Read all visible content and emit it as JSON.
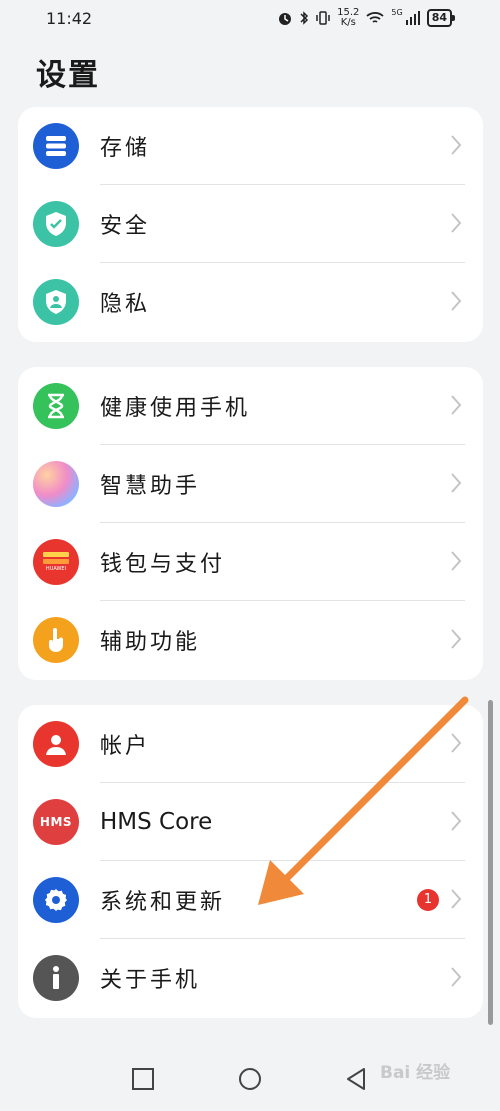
{
  "status_bar": {
    "time": "11:42",
    "speed_value": "15.2",
    "speed_unit": "K/s",
    "network": "5G",
    "battery": "84"
  },
  "page": {
    "title": "设置"
  },
  "groups": [
    {
      "items": [
        {
          "label": "存储",
          "icon": "storage-icon",
          "color": "#1f5fd6"
        },
        {
          "label": "安全",
          "icon": "security-shield-icon",
          "color": "#3cc3a6"
        },
        {
          "label": "隐私",
          "icon": "privacy-shield-icon",
          "color": "#3cc3a6"
        }
      ]
    },
    {
      "items": [
        {
          "label": "健康使用手机",
          "icon": "hourglass-icon",
          "color": "#35c25a"
        },
        {
          "label": "智慧助手",
          "icon": "assistant-orb-icon",
          "color": "#b0a0f0"
        },
        {
          "label": "钱包与支付",
          "icon": "wallet-icon",
          "color": "#e8362e"
        },
        {
          "label": "辅助功能",
          "icon": "hand-pointer-icon",
          "color": "#f4a21d"
        }
      ]
    },
    {
      "items": [
        {
          "label": "帐户",
          "icon": "account-icon",
          "color": "#e8362e"
        },
        {
          "label": "HMS Core",
          "icon": "hms-core-icon",
          "color": "#e03f3f"
        },
        {
          "label": "系统和更新",
          "icon": "gear-icon",
          "color": "#1f5fd6",
          "badge": "1"
        },
        {
          "label": "关于手机",
          "icon": "info-icon",
          "color": "#555555"
        }
      ]
    }
  ],
  "icons_text": {
    "wallet": "HUAWEI",
    "hms": "HMS"
  },
  "navigation": [
    "recent-apps-icon",
    "home-icon",
    "back-icon"
  ],
  "watermark": "Bai 经验",
  "colors": {
    "background": "#f1f3f5",
    "arrow": "#f08a3a",
    "badge": "#e8342e"
  }
}
